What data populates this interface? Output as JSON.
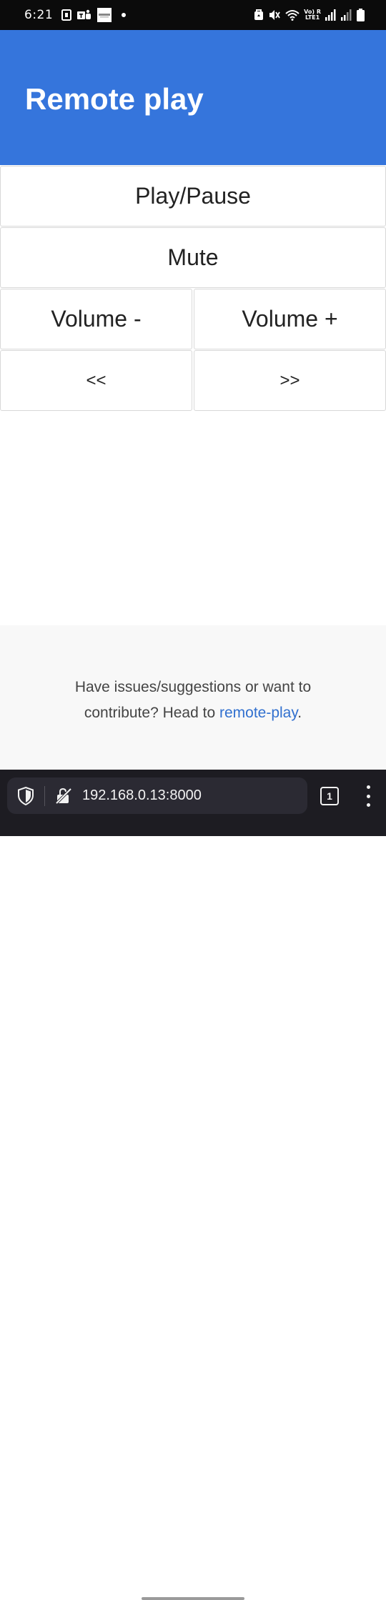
{
  "status_bar": {
    "time": "6:21",
    "network_line1": "Vo) R",
    "network_line2": "LTE1",
    "left_icons": [
      "screen-record-icon",
      "teams-icon",
      "notification-thumbnail-icon",
      "dot-icon"
    ],
    "right_icons": [
      "alarm-icon",
      "mute-icon",
      "wifi-icon",
      "signal-icon",
      "signal-icon-2",
      "battery-icon"
    ]
  },
  "header": {
    "title": "Remote play",
    "background": "#3575dc"
  },
  "controls": {
    "play_pause": "Play/Pause",
    "mute": "Mute",
    "volume_down": "Volume -",
    "volume_up": "Volume +",
    "previous": "<<",
    "next": ">>"
  },
  "footer": {
    "text_before": "Have issues/suggestions or want to contribute? Head to ",
    "link_text": "remote-play",
    "text_after": ".",
    "link_color": "#3170cf"
  },
  "browser": {
    "url": "192.168.0.13:8000",
    "tab_count": "1"
  }
}
